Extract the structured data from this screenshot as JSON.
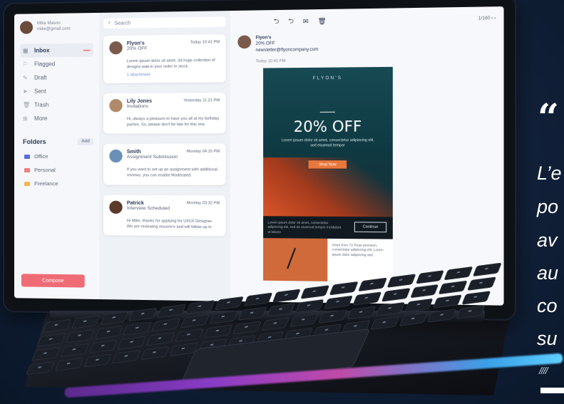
{
  "sidebar": {
    "user_name": "Mike Mason",
    "user_email": "mike@gmail.com",
    "items": [
      {
        "label": "Inbox",
        "badge": "",
        "icon": "inbox-icon"
      },
      {
        "label": "Flagged",
        "icon": "flag-icon"
      },
      {
        "label": "Draft",
        "icon": "draft-icon"
      },
      {
        "label": "Sent",
        "icon": "sent-icon"
      },
      {
        "label": "Trash",
        "icon": "trash-icon"
      },
      {
        "label": "More",
        "icon": "more-icon"
      }
    ],
    "folders_label": "Folders",
    "add_label": "Add",
    "folders": [
      {
        "label": "Office",
        "color": "#5b6fd6"
      },
      {
        "label": "Personal",
        "color": "#f07d7d"
      },
      {
        "label": "Freelance",
        "color": "#f5b84c"
      }
    ],
    "compose_label": "Compose"
  },
  "list": {
    "search_placeholder": "Search",
    "emails": [
      {
        "name": "Flyon's",
        "subject": "20% OFF",
        "date": "Today",
        "time": "10:41 PM",
        "snippet": "Lorem ipsum dolor sit amet. 3d huge collection of designs wait.in your order in stock.",
        "attachment": "1 attachment"
      },
      {
        "name": "Lily Jones",
        "subject": "Invitations",
        "date": "Yesterday",
        "time": "11:21 PM",
        "snippet": "Hi, always a pleasure to have you all at my birthday parties. So, please don't be late for this one."
      },
      {
        "name": "Smith",
        "subject": "Assignment Submission",
        "date": "Monday",
        "time": "04:15 PM",
        "snippet": "If you want to set up an assignment with additional reviews, you can enable Moderated"
      },
      {
        "name": "Patrick",
        "subject": "Interview Scheduled",
        "date": "Monday",
        "time": "03:32 PM",
        "snippet": "Hi Mike, thanks for applying for UI/UX Designer. We are reviewing resume's and will follow up in"
      }
    ]
  },
  "reader": {
    "pager": "1/160",
    "sender_name": "Flyon's",
    "sender_subject": "20% OFF",
    "sender_email": "newsletter@flyoncompany.com",
    "date": "Today 10:41 PM",
    "promo": {
      "brand": "FLYON'S",
      "title": "20% OFF",
      "text": "Lorem ipsum dolor sit amet, consectetur adipiscing elit, sed eiusmod tempor",
      "cta": "Shop Now",
      "footer_text": "Lorem ipsum dolor sit amet, consectetur adipiscing elit, sed do eiusmod tempor incididunt ut labore",
      "footer_btn": "Continue",
      "desc": "Ones from 72 Rose premium, consectetur adipiscing elit. Lorem ipsum dolor adipiscing sed."
    }
  },
  "quote": {
    "mark": "“",
    "lines": [
      "L’e",
      "po",
      "av",
      "au",
      "co",
      "su"
    ],
    "stripes": "////"
  }
}
